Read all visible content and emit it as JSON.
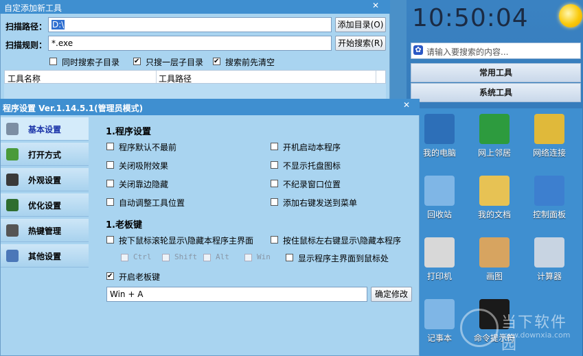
{
  "launcher": {
    "clock": "10:50:04",
    "search_placeholder": "请输入要搜索的内容...",
    "categories": [
      "常用工具",
      "系统工具"
    ],
    "tools": [
      {
        "label": "我的电脑",
        "icon": "computer-icon",
        "color": "#2d6fb8"
      },
      {
        "label": "网上邻居",
        "icon": "network-globe-icon",
        "color": "#2d9b3e"
      },
      {
        "label": "网络连接",
        "icon": "network-connection-icon",
        "color": "#e0b93a"
      },
      {
        "label": "回收站",
        "icon": "recycle-bin-icon",
        "color": "#7fb6e6"
      },
      {
        "label": "我的文档",
        "icon": "documents-folder-icon",
        "color": "#e7c254"
      },
      {
        "label": "控制面板",
        "icon": "control-panel-icon",
        "color": "#3d7fcf"
      },
      {
        "label": "打印机",
        "icon": "printer-icon",
        "color": "#d8d8d8"
      },
      {
        "label": "画图",
        "icon": "paint-palette-icon",
        "color": "#d7a460"
      },
      {
        "label": "计算器",
        "icon": "calculator-icon",
        "color": "#c8d4e2"
      },
      {
        "label": "记事本",
        "icon": "notepad-icon",
        "color": "#7fb6e6"
      },
      {
        "label": "命令提示符",
        "icon": "command-prompt-icon",
        "color": "#1a1a1a"
      }
    ]
  },
  "add_dialog": {
    "title": "自定添加新工具",
    "scan_path_label": "扫描路径：",
    "scan_path_value": "D:\\",
    "scan_rule_label": "扫描规则：",
    "scan_rule_value": "*.exe",
    "add_dir_button": "添加目录(O)",
    "start_search_button": "开始搜索(R)",
    "options": [
      {
        "label": "同时搜索子目录",
        "checked": false
      },
      {
        "label": "只搜一层子目录",
        "checked": true
      },
      {
        "label": "搜索前先清空",
        "checked": true
      }
    ],
    "columns": [
      "工具名称",
      "工具路径"
    ]
  },
  "settings_dialog": {
    "title": "程序设置  Ver.1.14.5.1(管理员模式)",
    "nav": [
      {
        "label": "基本设置",
        "icon": "gear-icon",
        "color": "#7c8ea3",
        "active": true
      },
      {
        "label": "打开方式",
        "icon": "open-with-icon",
        "color": "#4a9a3a",
        "active": false
      },
      {
        "label": "外观设置",
        "icon": "monitor-icon",
        "color": "#3a3a3a",
        "active": false
      },
      {
        "label": "优化设置",
        "icon": "optimize-icon",
        "color": "#2f6d2f",
        "active": false
      },
      {
        "label": "热键管理",
        "icon": "keyboard-icon",
        "color": "#555555",
        "active": false
      },
      {
        "label": "其他设置",
        "icon": "tools-icon",
        "color": "#4b77b8",
        "active": false
      }
    ],
    "section1_title": "1.程序设置",
    "section1_left": [
      {
        "label": "程序默认不最前",
        "checked": false
      },
      {
        "label": "关闭吸附效果",
        "checked": false
      },
      {
        "label": "关闭靠边隐藏",
        "checked": false
      },
      {
        "label": "自动调整工具位置",
        "checked": false
      }
    ],
    "section1_right": [
      {
        "label": "开机启动本程序",
        "checked": false
      },
      {
        "label": "不显示托盘图标",
        "checked": false
      },
      {
        "label": "不纪录窗口位置",
        "checked": false
      },
      {
        "label": "添加右键发送到菜单",
        "checked": false
      }
    ],
    "section2_title": "1.老板键",
    "wheel_option": "按下鼠标滚轮显示\\隐藏本程序主界面",
    "lr_option": "按住鼠标左右键显示\\隐藏本程序",
    "modifiers": [
      "Ctrl",
      "Shift",
      "Alt",
      "Win"
    ],
    "show_at_mouse": "显示程序主界面到鼠标处",
    "enable_boss_key": "开启老板键",
    "enable_boss_key_checked": true,
    "hotkey_value": "Win +  A",
    "confirm_button": "确定修改"
  },
  "watermark": {
    "main": "当下软件园",
    "sub": "www.downxia.com"
  }
}
